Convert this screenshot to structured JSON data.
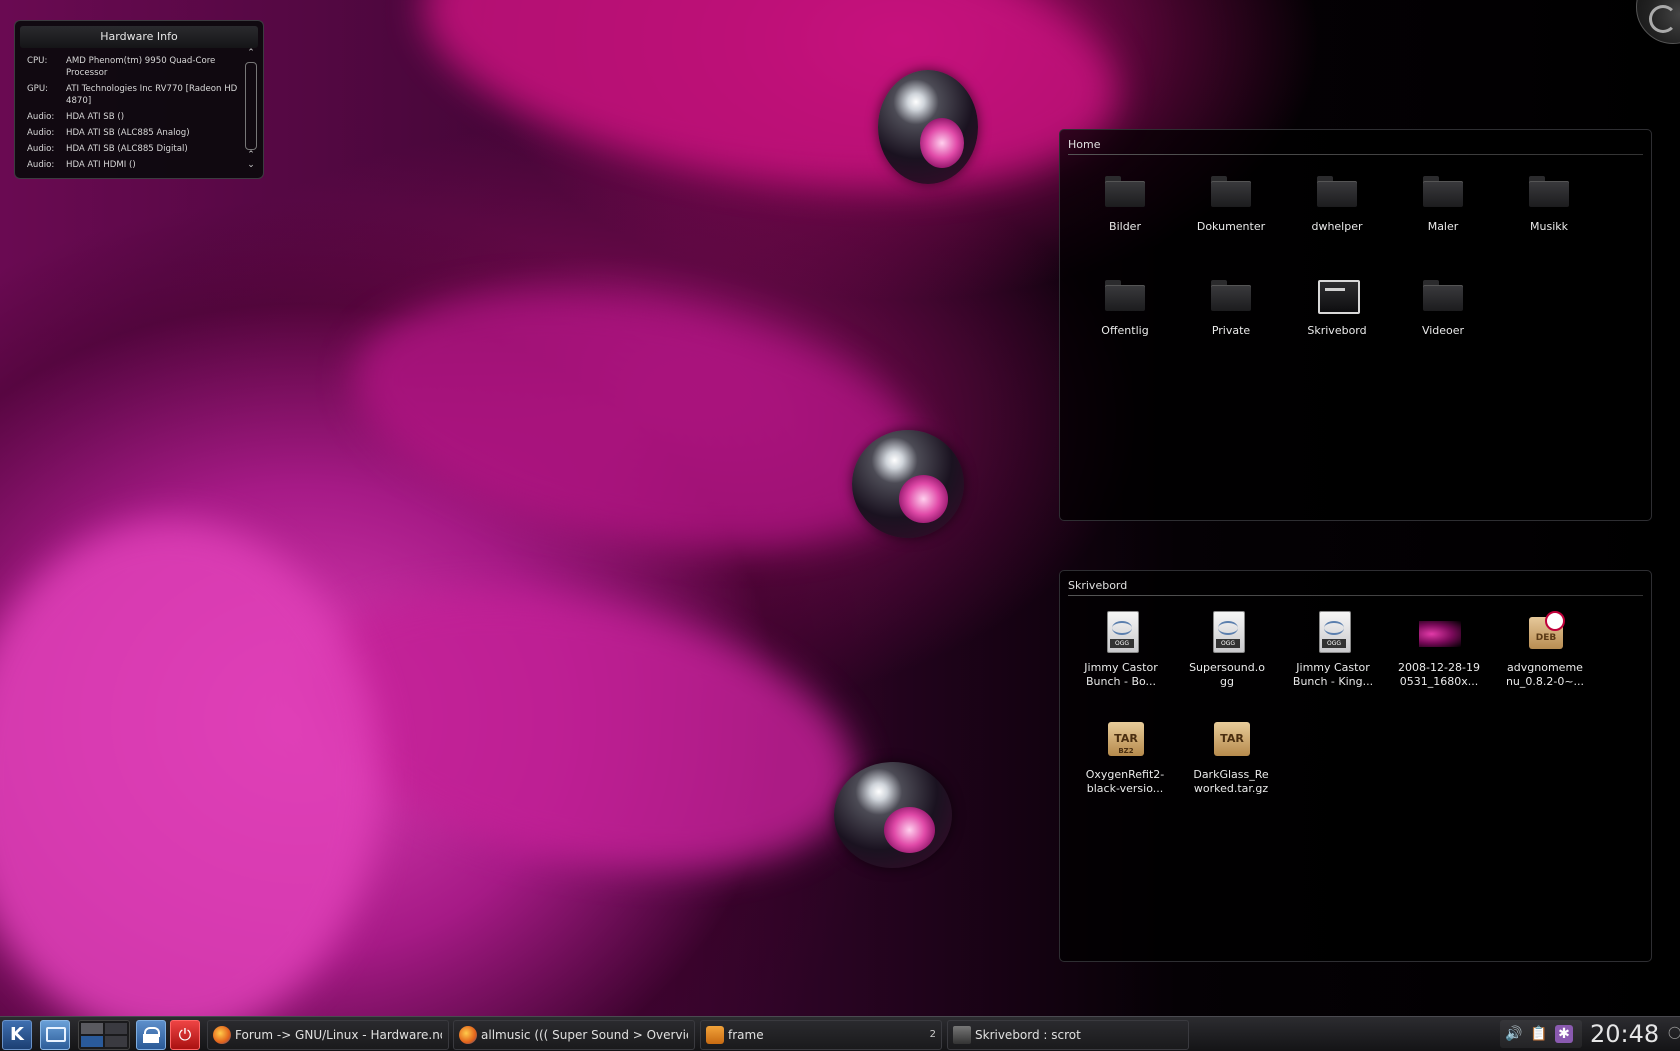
{
  "hardware_info": {
    "title": "Hardware Info",
    "rows": [
      {
        "key": "CPU:",
        "value": "AMD Phenom(tm) 9950 Quad-Core Processor"
      },
      {
        "key": "GPU:",
        "value": "ATI Technologies Inc RV770 [Radeon HD 4870]"
      },
      {
        "key": "Audio:",
        "value": "HDA ATI SB ()"
      },
      {
        "key": "Audio:",
        "value": "HDA ATI SB (ALC885 Analog)"
      },
      {
        "key": "Audio:",
        "value": "HDA ATI SB (ALC885 Digital)"
      },
      {
        "key": "Audio:",
        "value": "HDA ATI HDMI ()"
      }
    ]
  },
  "home_folder": {
    "title": "Home",
    "items": [
      {
        "label": "Bilder",
        "icon": "folder-icon"
      },
      {
        "label": "Dokumenter",
        "icon": "folder-icon"
      },
      {
        "label": "dwhelper",
        "icon": "folder-icon"
      },
      {
        "label": "Maler",
        "icon": "folder-icon"
      },
      {
        "label": "Musikk",
        "icon": "folder-icon"
      },
      {
        "label": "Offentlig",
        "icon": "folder-icon"
      },
      {
        "label": "Private",
        "icon": "folder-icon"
      },
      {
        "label": "Skrivebord",
        "icon": "desktop-folder-icon"
      },
      {
        "label": "Videoer",
        "icon": "folder-icon"
      }
    ]
  },
  "desktop_folder": {
    "title": "Skrivebord",
    "items": [
      {
        "line1": "Jimmy Castor",
        "line2": "Bunch - Bo...",
        "icon": "ogg-file-icon",
        "badge": "OGG"
      },
      {
        "line1": "Supersound.o",
        "line2": "gg",
        "icon": "ogg-file-icon",
        "badge": "OGG"
      },
      {
        "line1": "Jimmy Castor",
        "line2": "Bunch - King...",
        "icon": "ogg-file-icon",
        "badge": "OGG"
      },
      {
        "line1": "2008-12-28-19",
        "line2": "0531_1680x...",
        "icon": "image-file-icon"
      },
      {
        "line1": "advgnomeme",
        "line2": "nu_0.8.2-0~...",
        "icon": "deb-package-icon",
        "badge": "DEB"
      },
      {
        "line1": "OxygenRefit2-",
        "line2": "black-versio...",
        "icon": "tar-bz2-archive-icon",
        "badge": "TAR",
        "badge2": "BZ2"
      },
      {
        "line1": "DarkGlass_Re",
        "line2": "worked.tar.gz",
        "icon": "tar-archive-icon",
        "badge": "TAR"
      }
    ]
  },
  "taskbar": {
    "kmenu_icon": "kde-menu-icon",
    "tasks": [
      {
        "label": "Forum -> GNU/Linux - Hardware.no",
        "icon": "firefox-icon"
      },
      {
        "label": "allmusic ((( Super Sound > Overview",
        "icon": "firefox-icon"
      },
      {
        "label": "frame",
        "icon": "headphones-icon",
        "count": "2"
      },
      {
        "label": "Skrivebord : scrot",
        "icon": "terminal-icon"
      }
    ],
    "clock": "20:48"
  },
  "colors": {
    "wallpaper_pink": "#c21a8e",
    "panel_bg": "#141416",
    "kmenu_blue": "#3f6fb0",
    "power_red": "#d32020"
  }
}
